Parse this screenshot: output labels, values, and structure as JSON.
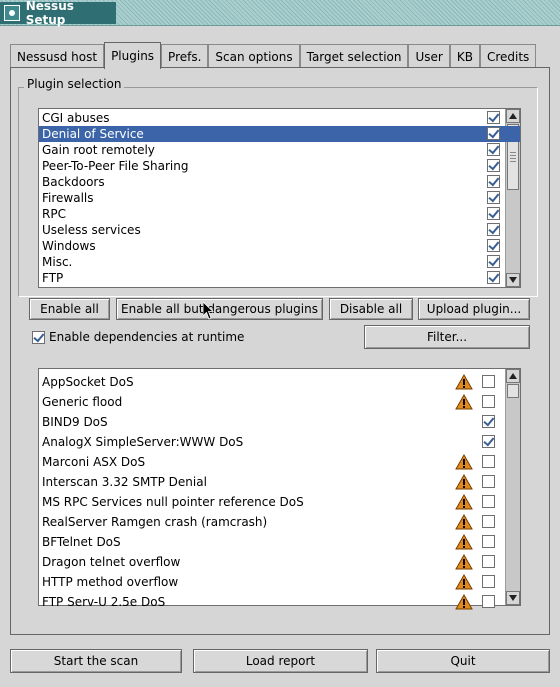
{
  "window": {
    "title": "Nessus Setup"
  },
  "tabs": [
    {
      "label": "Nessusd host"
    },
    {
      "label": "Plugins"
    },
    {
      "label": "Prefs."
    },
    {
      "label": "Scan options"
    },
    {
      "label": "Target selection"
    },
    {
      "label": "User"
    },
    {
      "label": "KB"
    },
    {
      "label": "Credits"
    }
  ],
  "active_tab": "Plugins",
  "plugin_selection": {
    "label": "Plugin selection",
    "families": [
      {
        "name": "CGI abuses",
        "enabled": true
      },
      {
        "name": "Denial of Service",
        "enabled": true,
        "selected": true
      },
      {
        "name": "Gain root remotely",
        "enabled": true
      },
      {
        "name": "Peer-To-Peer File Sharing",
        "enabled": true
      },
      {
        "name": "Backdoors",
        "enabled": true
      },
      {
        "name": "Firewalls",
        "enabled": true
      },
      {
        "name": "RPC",
        "enabled": true
      },
      {
        "name": "Useless services",
        "enabled": true
      },
      {
        "name": "Windows",
        "enabled": true
      },
      {
        "name": "Misc.",
        "enabled": true
      },
      {
        "name": "FTP",
        "enabled": true
      }
    ]
  },
  "buttons": {
    "enable_all": "Enable all",
    "enable_all_but_dangerous": "Enable all but dangerous plugins",
    "disable_all": "Disable all",
    "upload_plugin": "Upload plugin...",
    "filter": "Filter...",
    "start_scan": "Start the scan",
    "load_report": "Load report",
    "quit": "Quit"
  },
  "dependencies": {
    "label": "Enable dependencies at runtime",
    "checked": true
  },
  "plugins": [
    {
      "name": "AppSocket DoS",
      "dangerous": true,
      "enabled": false
    },
    {
      "name": "Generic flood",
      "dangerous": true,
      "enabled": false
    },
    {
      "name": "BIND9 DoS",
      "dangerous": false,
      "enabled": true
    },
    {
      "name": "AnalogX SimpleServer:WWW  DoS",
      "dangerous": false,
      "enabled": true
    },
    {
      "name": "Marconi ASX DoS",
      "dangerous": true,
      "enabled": false
    },
    {
      "name": "Interscan 3.32 SMTP Denial",
      "dangerous": true,
      "enabled": false
    },
    {
      "name": "MS RPC Services null pointer reference DoS",
      "dangerous": true,
      "enabled": false
    },
    {
      "name": "RealServer Ramgen crash (ramcrash)",
      "dangerous": true,
      "enabled": false
    },
    {
      "name": "BFTelnet DoS",
      "dangerous": true,
      "enabled": false
    },
    {
      "name": "Dragon telnet overflow",
      "dangerous": true,
      "enabled": false
    },
    {
      "name": "HTTP method overflow",
      "dangerous": true,
      "enabled": false
    },
    {
      "name": "FTP Serv-U 2.5e DoS",
      "dangerous": true,
      "enabled": false
    }
  ],
  "colors": {
    "selection": "#3c64a8",
    "warning": "#e08a1e",
    "titlebar": "#2f6f73"
  }
}
